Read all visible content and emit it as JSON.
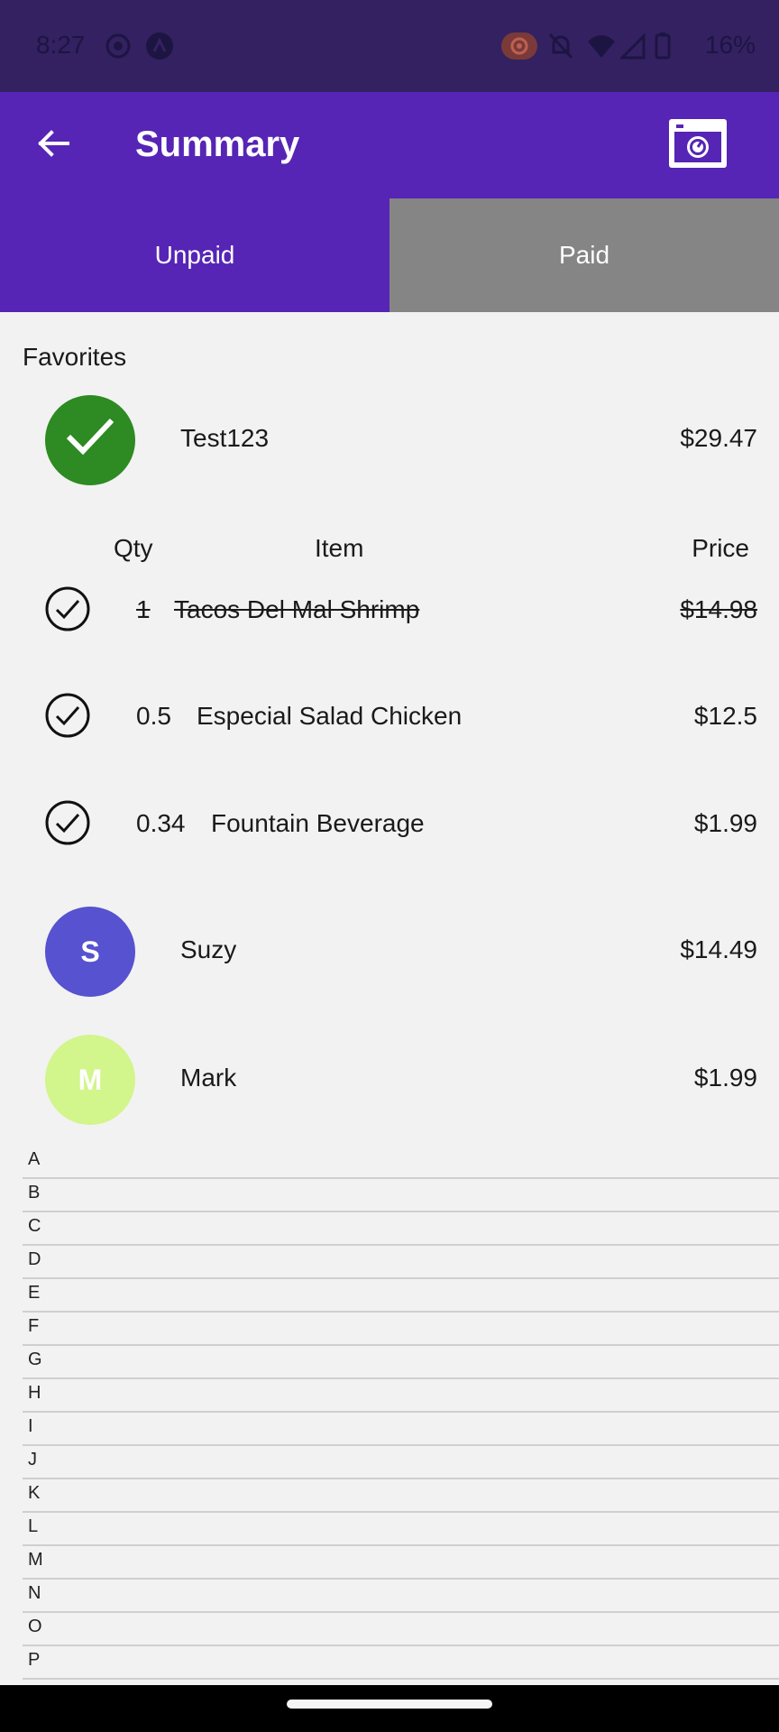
{
  "status_bar": {
    "time": "8:27",
    "battery": "16%"
  },
  "app_bar": {
    "title": "Summary",
    "back_icon": "arrow-back-icon",
    "camera_icon": "camera-icon"
  },
  "tabs": [
    {
      "label": "Unpaid",
      "selected": true
    },
    {
      "label": "Paid",
      "selected": false
    }
  ],
  "favorites": {
    "label": "Favorites",
    "main_person": {
      "name": "Test123",
      "amount": "$29.47",
      "avatar_color": "#2e8a22"
    }
  },
  "columns": {
    "qty": "Qty",
    "item": "Item",
    "price": "Price"
  },
  "items": [
    {
      "qty": "1",
      "name": "Tacos Del Mal Shrimp",
      "price": "$14.98",
      "struck": true
    },
    {
      "qty": "0.5",
      "name": "Especial Salad Chicken",
      "price": "$12.5",
      "struck": false
    },
    {
      "qty": "0.34",
      "name": "Fountain Beverage",
      "price": "$1.99",
      "struck": false
    }
  ],
  "people": [
    {
      "initial": "S",
      "name": "Suzy",
      "amount": "$14.49",
      "avatar_color": "#5652d0"
    },
    {
      "initial": "M",
      "name": "Mark",
      "amount": "$1.99",
      "avatar_color": "#d2f58c"
    }
  ],
  "alphabet": [
    "A",
    "B",
    "C",
    "D",
    "E",
    "F",
    "G",
    "H",
    "I",
    "J",
    "K",
    "L",
    "M",
    "N",
    "O",
    "P"
  ],
  "colors": {
    "primary": "#5625b5",
    "status_bar": "#342161",
    "tab_inactive": "#858585"
  }
}
